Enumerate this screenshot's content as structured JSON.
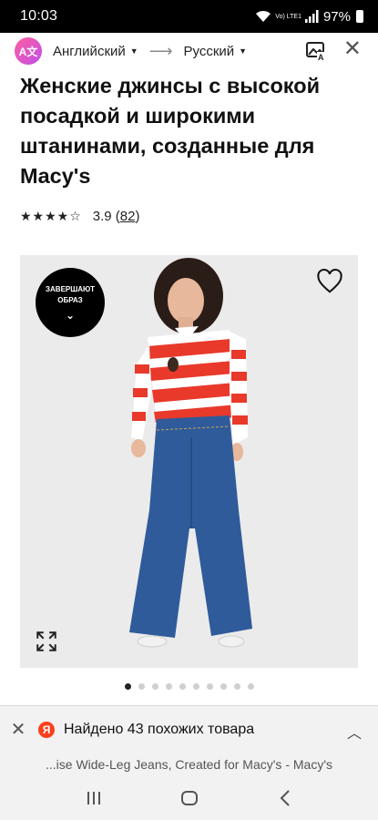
{
  "status": {
    "time": "10:03",
    "volte": "Vo) LTE1",
    "battery": "97%"
  },
  "translator": {
    "source_lang": "Английский",
    "target_lang": "Русский",
    "logo_icon": "translate-logo-icon"
  },
  "product": {
    "title": "Женские джинсы с высокой посадкой и широкими штанинами, созданные для Macy's",
    "stars": "★★★★☆",
    "rating": "3.9",
    "reviews": "82",
    "badge_line1": "ЗАВЕРШАЮТ",
    "badge_line2": "ОБРАЗ"
  },
  "gallery": {
    "dots": [
      true,
      false,
      false,
      false,
      false,
      false,
      false,
      false,
      false,
      false
    ]
  },
  "similar": {
    "text": "Найдено 43 похожих товара",
    "yandex_letter": "Я"
  },
  "url": {
    "text": "...ise Wide-Leg Jeans, Created for Macy's - Macy's"
  },
  "colors": {
    "badge": "#000000",
    "stripe_red": "#e8392b",
    "denim": "#2f5b9a",
    "yandex": "#fc3f1d"
  }
}
